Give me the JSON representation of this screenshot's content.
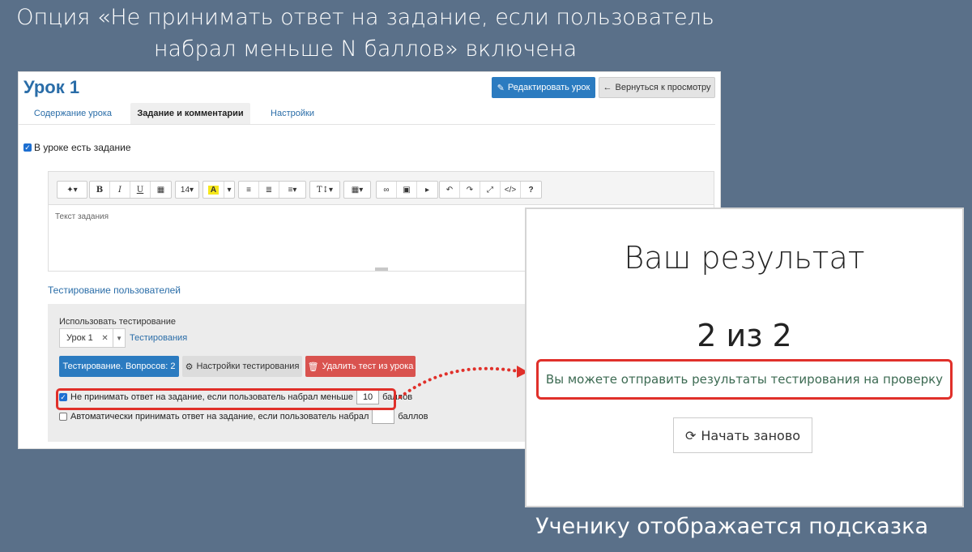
{
  "headline": {
    "line1": "Опция «Не принимать ответ на задание, если пользователь",
    "line2": "набрал меньше N баллов» включена"
  },
  "footer_caption": "Ученику отображается подсказка",
  "editor": {
    "title": "Урок 1",
    "edit_button": "Редактировать урок",
    "back_button": "Вернуться к просмотру",
    "tabs": [
      {
        "label": "Содержание урока",
        "active": false
      },
      {
        "label": "Задание и комментарии",
        "active": true
      },
      {
        "label": "Настройки",
        "active": false
      }
    ],
    "has_task_label": "В уроке есть задание",
    "has_task_checked": true,
    "toolbar": {
      "font_size": "14",
      "highlight_color": "#f6e71b"
    },
    "task_placeholder": "Текст задания",
    "testing_title": "Тестирование пользователей",
    "use_testing_label": "Использовать тестирование",
    "selected_test": "Урок 1",
    "tests_link": "Тестирования",
    "testing_button": "Тестирование. Вопросов: 2",
    "settings_button": "Настройки тестирования",
    "delete_button": "Удалить тест из урока",
    "option1": {
      "label": "Не принимать ответ на задание, если пользователь набрал меньше",
      "value": "10",
      "suffix": "баллов",
      "checked": true
    },
    "option2": {
      "label": "Автоматически принимать ответ на задание, если пользователь набрал",
      "value": "",
      "suffix": "баллов",
      "checked": false
    }
  },
  "result": {
    "title": "Ваш результат",
    "score": "2 из 2",
    "hint": "Вы можете отправить результаты тестирования на проверку",
    "restart_button": "Начать заново"
  },
  "colors": {
    "background": "#5a7089",
    "primary": "#2b7bc0",
    "danger": "#d9534f",
    "highlight_border": "#e0302a",
    "hint_text": "#3c6a52"
  }
}
